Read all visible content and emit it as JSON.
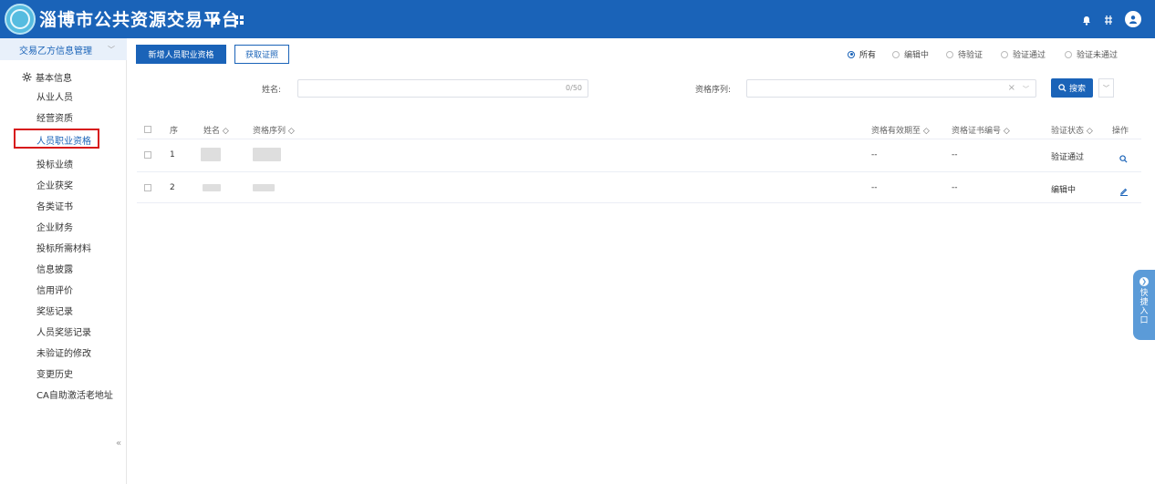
{
  "header": {
    "title": "淄博市公共资源交易平台"
  },
  "sidebar": {
    "group_label": "交易乙方信息管理",
    "section_label": "基本信息",
    "items": [
      {
        "label": "从业人员"
      },
      {
        "label": "经营资质"
      },
      {
        "label": "人员职业资格"
      },
      {
        "label": "投标业绩"
      },
      {
        "label": "企业获奖"
      },
      {
        "label": "各类证书"
      },
      {
        "label": "企业财务"
      },
      {
        "label": "投标所需材料"
      },
      {
        "label": "信息披露"
      },
      {
        "label": "信用评价"
      },
      {
        "label": "奖惩记录"
      },
      {
        "label": "人员奖惩记录"
      },
      {
        "label": "未验证的修改"
      },
      {
        "label": "变更历史"
      },
      {
        "label": "CA自助激活老地址"
      }
    ],
    "collapse_glyph": "«"
  },
  "toolbar": {
    "add_label": "新增人员职业资格",
    "fetch_label": "获取证照"
  },
  "filters": [
    {
      "label": "所有",
      "selected": true
    },
    {
      "label": "编辑中",
      "selected": false
    },
    {
      "label": "待验证",
      "selected": false
    },
    {
      "label": "验证通过",
      "selected": false
    },
    {
      "label": "验证未通过",
      "selected": false
    }
  ],
  "search": {
    "name_label": "姓名:",
    "name_counter": "0/50",
    "series_label": "资格序列:",
    "search_label": "搜索",
    "clear_glyph": "×"
  },
  "table": {
    "headers": {
      "seq": "序",
      "name": "姓名",
      "series": "资格序列",
      "valid": "资格有效期至",
      "cert": "资格证书编号",
      "status": "验证状态",
      "ops": "操作"
    },
    "rows": [
      {
        "seq": "1",
        "valid": "--",
        "cert": "--",
        "status": "验证通过"
      },
      {
        "seq": "2",
        "valid": "--",
        "cert": "--",
        "status": "编辑中"
      }
    ]
  },
  "quick_entry": {
    "label": "快捷入口"
  },
  "colors": {
    "brand": "#1a63b8",
    "highlight_border": "#d7191b",
    "quick_entry": "#5b9bd8"
  }
}
